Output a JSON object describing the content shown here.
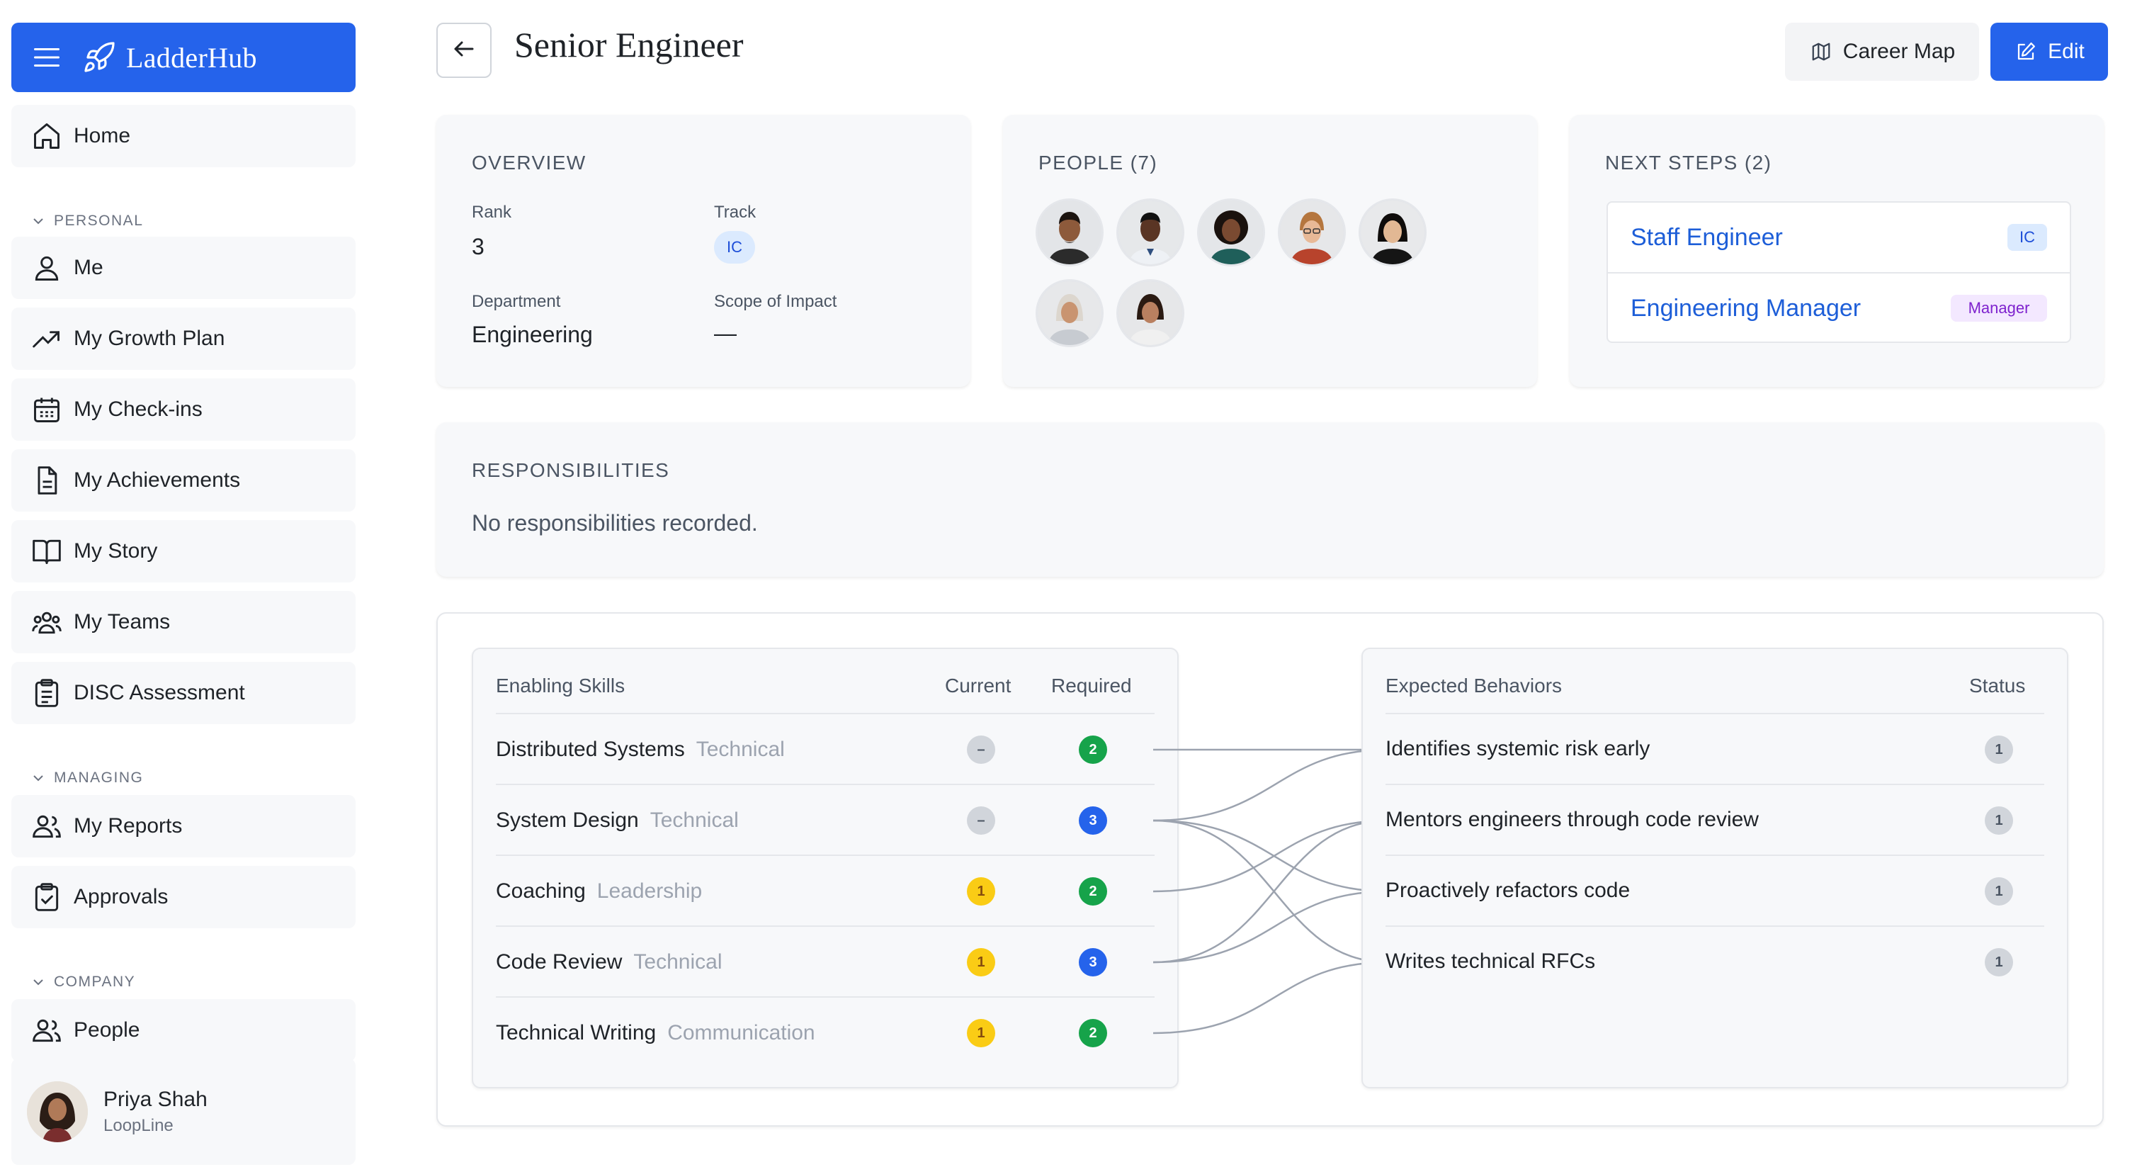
{
  "app": {
    "name": "LadderHub"
  },
  "nav": {
    "home": "Home",
    "sections": {
      "personal": "PERSONAL",
      "managing": "MANAGING",
      "company": "COMPANY"
    },
    "personal_items": [
      "Me",
      "My Growth Plan",
      "My Check-ins",
      "My Achievements",
      "My Story",
      "My Teams",
      "DISC Assessment"
    ],
    "managing_items": [
      "My Reports",
      "Approvals"
    ],
    "company_items": [
      "People"
    ]
  },
  "user": {
    "name": "Priya Shah",
    "org": "LoopLine"
  },
  "header": {
    "title": "Senior Engineer",
    "career_map": "Career Map",
    "edit": "Edit"
  },
  "overview": {
    "title": "OVERVIEW",
    "rank_label": "Rank",
    "rank_value": "3",
    "track_label": "Track",
    "track_value": "IC",
    "department_label": "Department",
    "department_value": "Engineering",
    "scope_label": "Scope of Impact",
    "scope_value": "—"
  },
  "people": {
    "title": "PEOPLE (7)"
  },
  "next_steps": {
    "title": "NEXT STEPS (2)",
    "items": [
      {
        "name": "Staff Engineer",
        "badge": "IC"
      },
      {
        "name": "Engineering Manager",
        "badge": "Manager"
      }
    ]
  },
  "responsibilities": {
    "title": "RESPONSIBILITIES",
    "empty": "No responsibilities recorded."
  },
  "skills": {
    "headers": {
      "name": "Enabling Skills",
      "current": "Current",
      "required": "Required"
    },
    "rows": [
      {
        "name": "Distributed Systems",
        "category": "Technical",
        "current": "–",
        "required": "2"
      },
      {
        "name": "System Design",
        "category": "Technical",
        "current": "–",
        "required": "3"
      },
      {
        "name": "Coaching",
        "category": "Leadership",
        "current": "1",
        "required": "2"
      },
      {
        "name": "Code Review",
        "category": "Technical",
        "current": "1",
        "required": "3"
      },
      {
        "name": "Technical Writing",
        "category": "Communication",
        "current": "1",
        "required": "2"
      }
    ]
  },
  "behaviors": {
    "headers": {
      "name": "Expected Behaviors",
      "status": "Status"
    },
    "rows": [
      {
        "name": "Identifies systemic risk early",
        "status": "1"
      },
      {
        "name": "Mentors engineers through code review",
        "status": "1"
      },
      {
        "name": "Proactively refactors code",
        "status": "1"
      },
      {
        "name": "Writes technical RFCs",
        "status": "1"
      }
    ]
  },
  "colors": {
    "accent": "#2563eb",
    "dot_green": "#16a34a",
    "dot_blue": "#2563eb",
    "dot_yellow": "#facc15",
    "dot_gray": "#d1d5db"
  }
}
